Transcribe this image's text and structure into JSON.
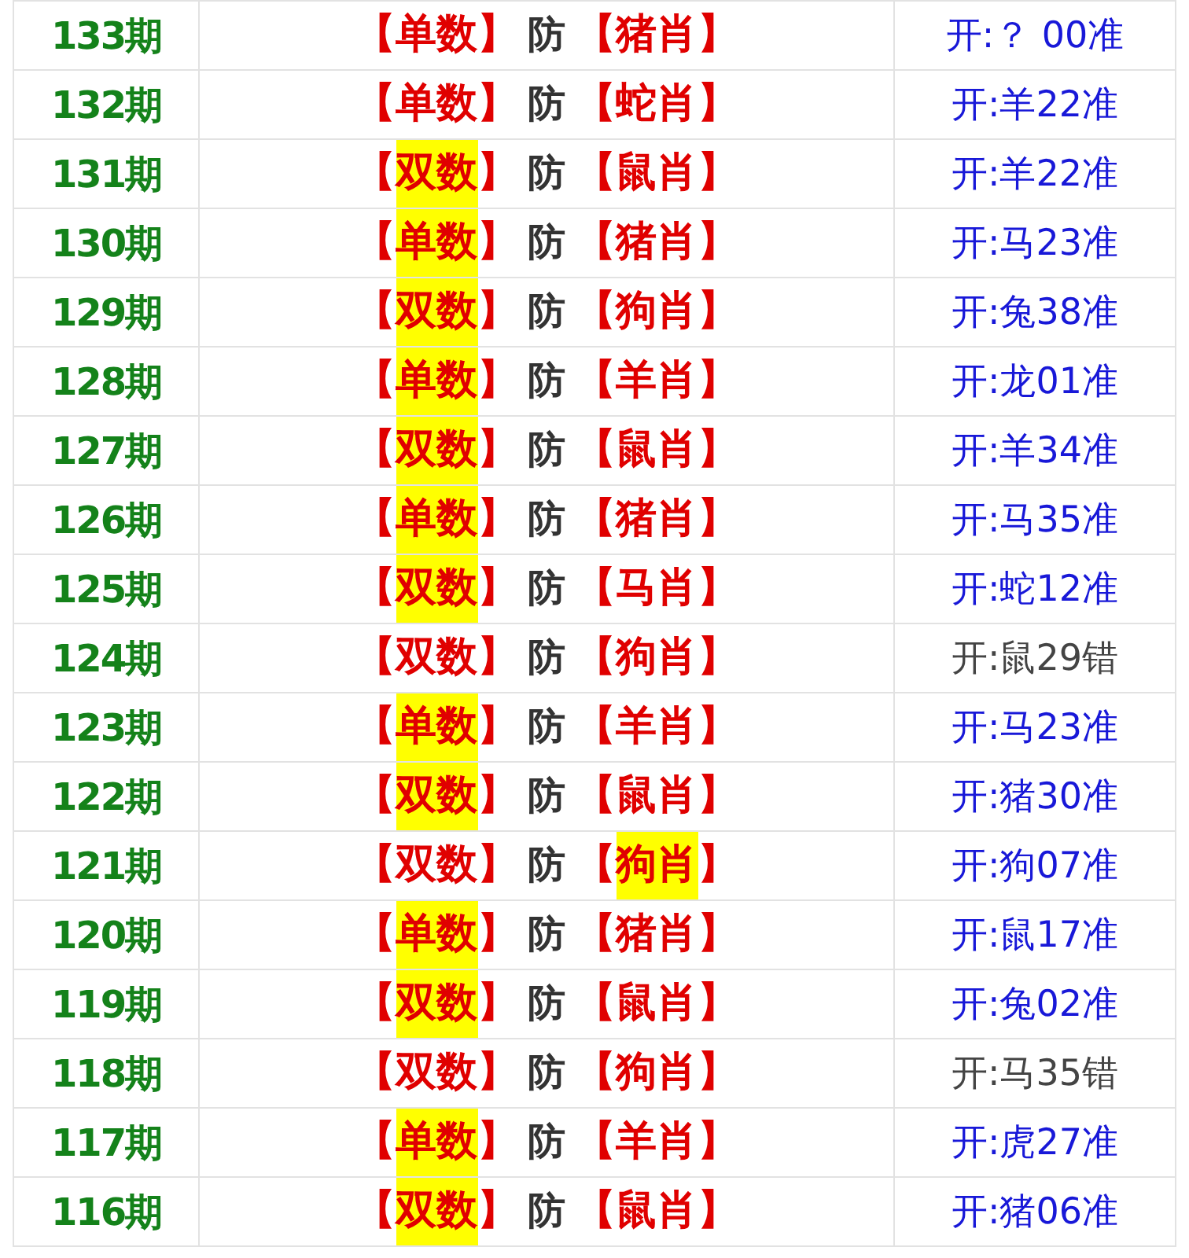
{
  "rows": [
    {
      "period": "133期",
      "parity": {
        "open": "【",
        "text": "单数",
        "close": "】",
        "hit": false
      },
      "guard": "防",
      "zodiac": {
        "open": "【",
        "text": "猪肖",
        "close": "】",
        "hit": false
      },
      "result": "开:？ 00准",
      "correct": true
    },
    {
      "period": "132期",
      "parity": {
        "open": "【",
        "text": "单数",
        "close": "】",
        "hit": false
      },
      "guard": "防",
      "zodiac": {
        "open": "【",
        "text": "蛇肖",
        "close": "】",
        "hit": false
      },
      "result": "开:羊22准",
      "correct": true
    },
    {
      "period": "131期",
      "parity": {
        "open": "【",
        "text": "双数",
        "close": "】",
        "hit": true
      },
      "guard": "防",
      "zodiac": {
        "open": "【",
        "text": "鼠肖",
        "close": "】",
        "hit": false
      },
      "result": "开:羊22准",
      "correct": true
    },
    {
      "period": "130期",
      "parity": {
        "open": "【",
        "text": "单数",
        "close": "】",
        "hit": true
      },
      "guard": "防",
      "zodiac": {
        "open": "【",
        "text": "猪肖",
        "close": "】",
        "hit": false
      },
      "result": "开:马23准",
      "correct": true
    },
    {
      "period": "129期",
      "parity": {
        "open": "【",
        "text": "双数",
        "close": "】",
        "hit": true
      },
      "guard": "防",
      "zodiac": {
        "open": "【",
        "text": "狗肖",
        "close": "】",
        "hit": false
      },
      "result": "开:兔38准",
      "correct": true
    },
    {
      "period": "128期",
      "parity": {
        "open": "【",
        "text": "单数",
        "close": "】",
        "hit": true
      },
      "guard": "防",
      "zodiac": {
        "open": "【",
        "text": "羊肖",
        "close": "】",
        "hit": false
      },
      "result": "开:龙01准",
      "correct": true
    },
    {
      "period": "127期",
      "parity": {
        "open": "【",
        "text": "双数",
        "close": "】",
        "hit": true
      },
      "guard": "防",
      "zodiac": {
        "open": "【",
        "text": "鼠肖",
        "close": "】",
        "hit": false
      },
      "result": "开:羊34准",
      "correct": true
    },
    {
      "period": "126期",
      "parity": {
        "open": "【",
        "text": "单数",
        "close": "】",
        "hit": true
      },
      "guard": "防",
      "zodiac": {
        "open": "【",
        "text": "猪肖",
        "close": "】",
        "hit": false
      },
      "result": "开:马35准",
      "correct": true
    },
    {
      "period": "125期",
      "parity": {
        "open": "【",
        "text": "双数",
        "close": "】",
        "hit": true
      },
      "guard": "防",
      "zodiac": {
        "open": "【",
        "text": "马肖",
        "close": "】",
        "hit": false
      },
      "result": "开:蛇12准",
      "correct": true
    },
    {
      "period": "124期",
      "parity": {
        "open": "【",
        "text": "双数",
        "close": "】",
        "hit": false
      },
      "guard": "防",
      "zodiac": {
        "open": "【",
        "text": "狗肖",
        "close": "】",
        "hit": false
      },
      "result": "开:鼠29错",
      "correct": false
    },
    {
      "period": "123期",
      "parity": {
        "open": "【",
        "text": "单数",
        "close": "】",
        "hit": true
      },
      "guard": "防",
      "zodiac": {
        "open": "【",
        "text": "羊肖",
        "close": "】",
        "hit": false
      },
      "result": "开:马23准",
      "correct": true
    },
    {
      "period": "122期",
      "parity": {
        "open": "【",
        "text": "双数",
        "close": "】",
        "hit": true
      },
      "guard": "防",
      "zodiac": {
        "open": "【",
        "text": "鼠肖",
        "close": "】",
        "hit": false
      },
      "result": "开:猪30准",
      "correct": true
    },
    {
      "period": "121期",
      "parity": {
        "open": "【",
        "text": "双数",
        "close": "】",
        "hit": false
      },
      "guard": "防",
      "zodiac": {
        "open": "【",
        "text": "狗肖",
        "close": "】",
        "hit": true
      },
      "result": "开:狗07准",
      "correct": true
    },
    {
      "period": "120期",
      "parity": {
        "open": "【",
        "text": "单数",
        "close": "】",
        "hit": true
      },
      "guard": "防",
      "zodiac": {
        "open": "【",
        "text": "猪肖",
        "close": "】",
        "hit": false
      },
      "result": "开:鼠17准",
      "correct": true
    },
    {
      "period": "119期",
      "parity": {
        "open": "【",
        "text": "双数",
        "close": "】",
        "hit": true
      },
      "guard": "防",
      "zodiac": {
        "open": "【",
        "text": "鼠肖",
        "close": "】",
        "hit": false
      },
      "result": "开:兔02准",
      "correct": true
    },
    {
      "period": "118期",
      "parity": {
        "open": "【",
        "text": "双数",
        "close": "】",
        "hit": false
      },
      "guard": "防",
      "zodiac": {
        "open": "【",
        "text": "狗肖",
        "close": "】",
        "hit": false
      },
      "result": "开:马35错",
      "correct": false
    },
    {
      "period": "117期",
      "parity": {
        "open": "【",
        "text": "单数",
        "close": "】",
        "hit": true
      },
      "guard": "防",
      "zodiac": {
        "open": "【",
        "text": "羊肖",
        "close": "】",
        "hit": false
      },
      "result": "开:虎27准",
      "correct": true
    },
    {
      "period": "116期",
      "parity": {
        "open": "【",
        "text": "双数",
        "close": "】",
        "hit": true
      },
      "guard": "防",
      "zodiac": {
        "open": "【",
        "text": "鼠肖",
        "close": "】",
        "hit": false
      },
      "result": "开:猪06准",
      "correct": true
    }
  ]
}
